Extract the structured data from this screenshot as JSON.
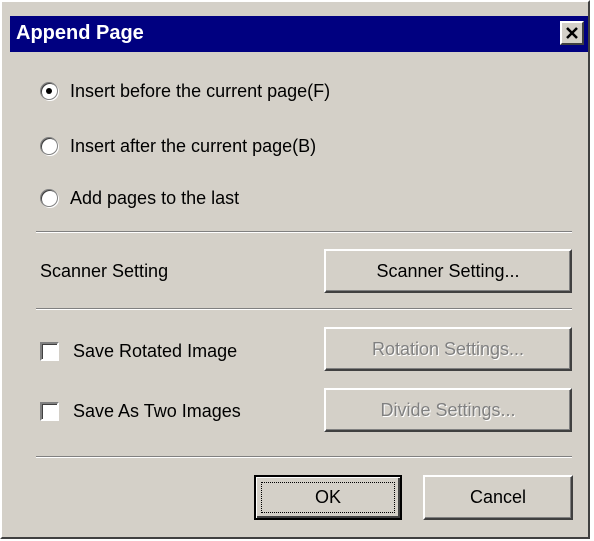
{
  "dialog": {
    "title": "Append Page",
    "close_icon": "close-icon"
  },
  "insert_options": [
    {
      "label": "Insert before the current page(F)",
      "checked": true
    },
    {
      "label": "Insert after the current page(B)",
      "checked": false
    },
    {
      "label": "Add pages to the last",
      "checked": false
    }
  ],
  "scanner": {
    "label": "Scanner Setting",
    "button": "Scanner Setting..."
  },
  "rotation": {
    "checkbox_label": "Save Rotated Image",
    "checked": false,
    "button": "Rotation Settings..."
  },
  "divide": {
    "checkbox_label": "Save As Two Images",
    "checked": false,
    "button": "Divide Settings..."
  },
  "footer": {
    "ok": "OK",
    "cancel": "Cancel"
  }
}
